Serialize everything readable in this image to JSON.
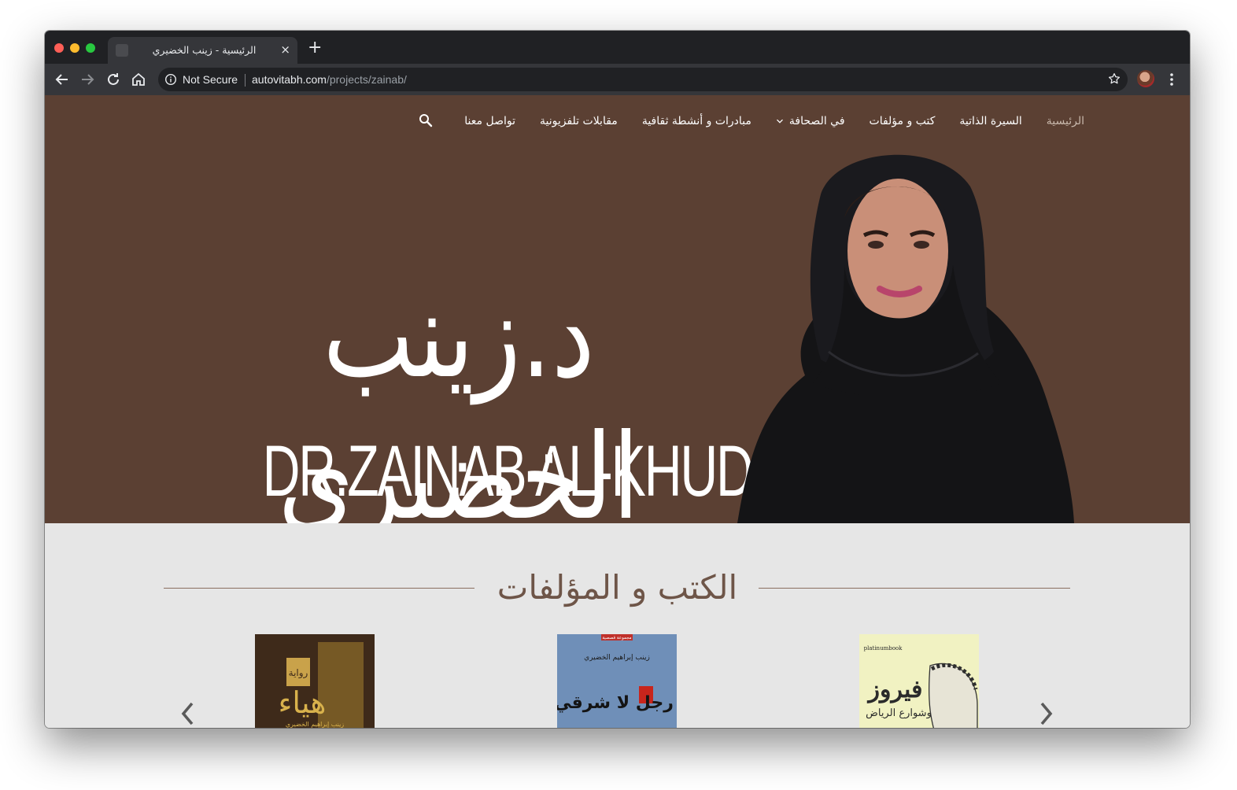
{
  "browser": {
    "tab_title": "الرئيسية - زينب الخضيري",
    "tab_close": "×",
    "new_tab": "+",
    "security_label": "Not Secure",
    "url_host": "autovitabh.com",
    "url_path": "/projects/zainab/"
  },
  "nav": {
    "items": [
      {
        "label": "الرئيسية",
        "active": true
      },
      {
        "label": "السيرة الذاتية"
      },
      {
        "label": "كتب و مؤلفات"
      },
      {
        "label": "في الصحافة",
        "has_dropdown": true
      },
      {
        "label": "مبادرات و أنشطة ثقافية"
      },
      {
        "label": "مقابلات تلفزيونية"
      },
      {
        "label": "تواصل معنا"
      }
    ]
  },
  "hero": {
    "title_ar": "د.زينب الخضيري",
    "title_en": "DR.ZAINAB AL-KHUDHAIRI",
    "background": "#5b4033"
  },
  "books_section": {
    "title": "الكتب و المؤلفات",
    "books": [
      {
        "title": "هياء",
        "badge": "رواية",
        "author": "زينب إبراهيم الخضيري"
      },
      {
        "title": "رجل لا شرقي",
        "badge": "مجموعة قصصية",
        "author": "زينب إبراهيم الخضيري"
      },
      {
        "title": "فيروز",
        "subtitle": "وشوارع الرياض",
        "publisher": "platinumbook"
      }
    ]
  },
  "colors": {
    "hero_bg": "#5b4033",
    "section_bg": "#e6e6e6",
    "accent_text": "#6e5548"
  }
}
